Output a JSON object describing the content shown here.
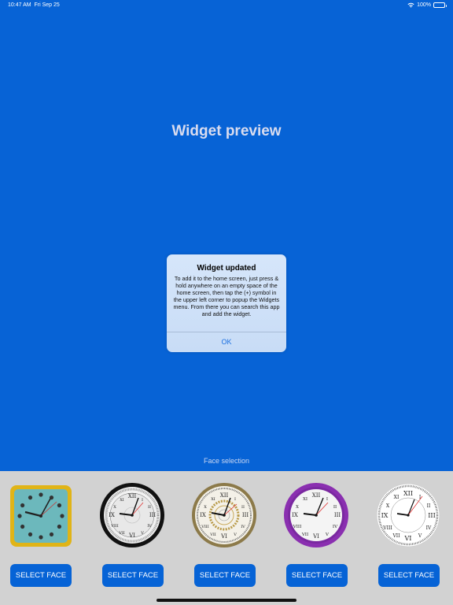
{
  "status_bar": {
    "time": "10:47 AM",
    "date": "Fri Sep 25",
    "battery": "100%"
  },
  "preview": {
    "title": "Widget preview"
  },
  "dialog": {
    "title": "Widget updated",
    "message": "To add it to the home screen, just press & hold anywhere on an empty space of the home screen, then tap the (+) symbol in the upper left corner to popup the Widgets menu. From there you can search this app and add the widget.",
    "ok_label": "OK"
  },
  "face_selection": {
    "label": "Face selection",
    "faces": [
      {
        "name": "teal-square-face",
        "select_label": "SELECT FACE"
      },
      {
        "name": "black-roman-face",
        "select_label": "SELECT FACE"
      },
      {
        "name": "gold-ornate-face",
        "select_label": "SELECT FACE"
      },
      {
        "name": "purple-roman-face",
        "select_label": "SELECT FACE"
      },
      {
        "name": "white-roman-face",
        "select_label": "SELECT FACE"
      }
    ]
  },
  "colors": {
    "background": "#0763d6",
    "button": "#0663d6",
    "panel": "#d2d2d2",
    "ok_text": "#1a6fe0"
  }
}
